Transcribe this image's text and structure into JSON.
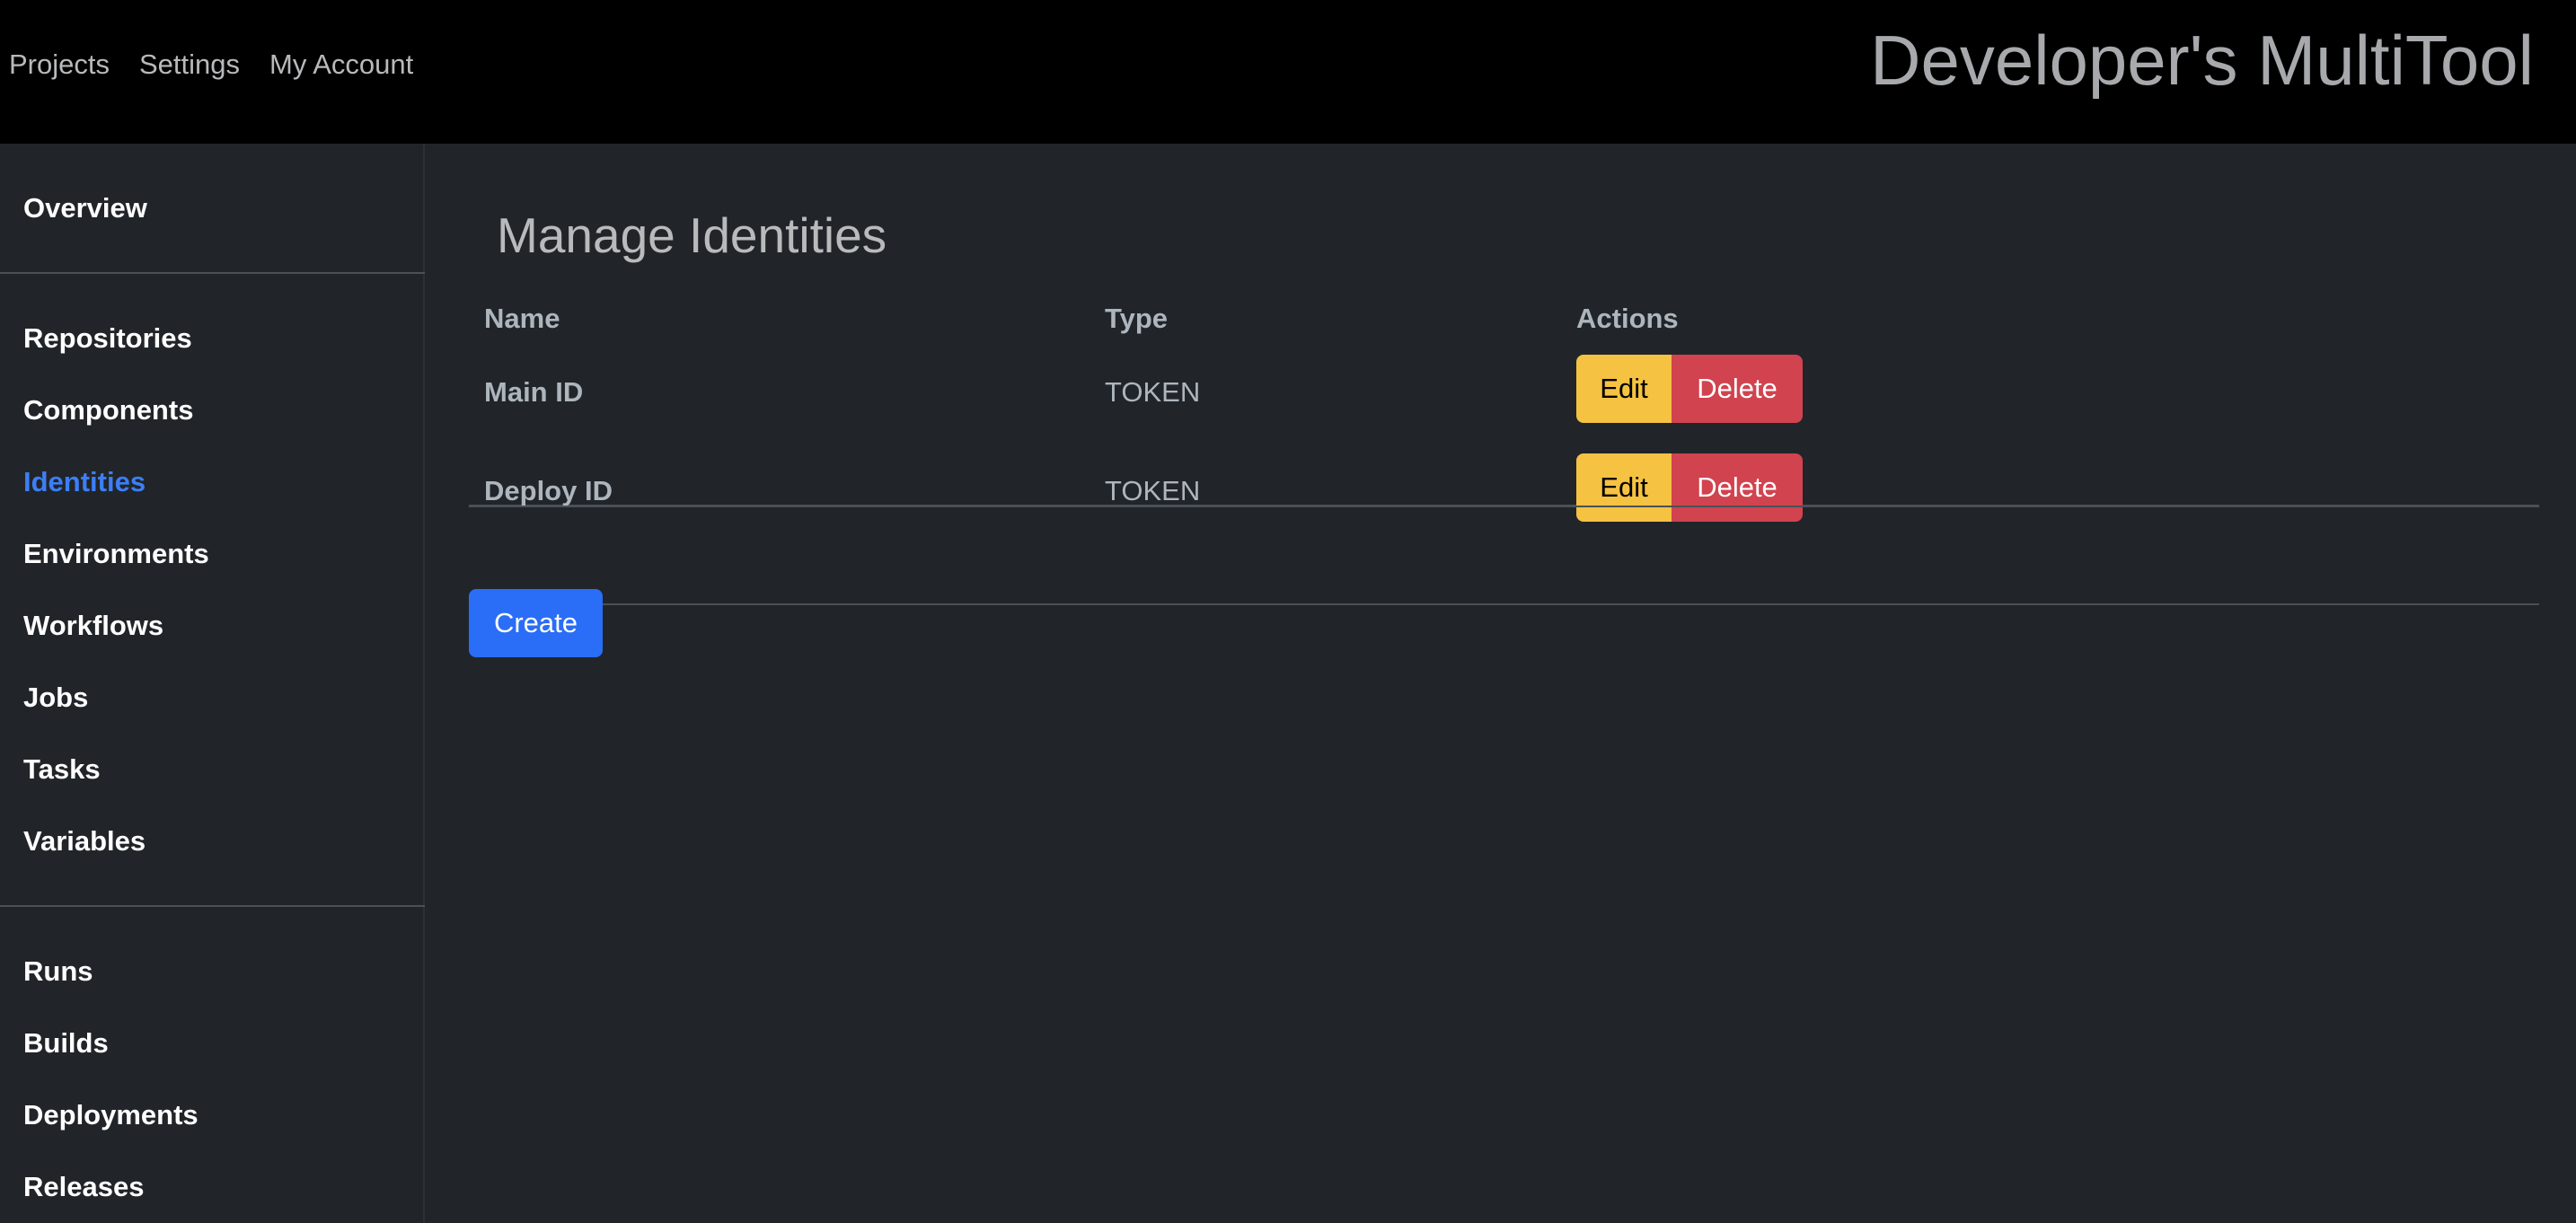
{
  "header": {
    "nav": [
      "Projects",
      "Settings",
      "My Account"
    ],
    "brand": "Developer's MultiTool"
  },
  "sidebar": {
    "groups": [
      [
        {
          "label": "Overview",
          "active": false
        }
      ],
      [
        {
          "label": "Repositories",
          "active": false
        },
        {
          "label": "Components",
          "active": false
        },
        {
          "label": "Identities",
          "active": true
        },
        {
          "label": "Environments",
          "active": false
        },
        {
          "label": "Workflows",
          "active": false
        },
        {
          "label": "Jobs",
          "active": false
        },
        {
          "label": "Tasks",
          "active": false
        },
        {
          "label": "Variables",
          "active": false
        }
      ],
      [
        {
          "label": "Runs",
          "active": false
        },
        {
          "label": "Builds",
          "active": false
        },
        {
          "label": "Deployments",
          "active": false
        },
        {
          "label": "Releases",
          "active": false
        }
      ]
    ]
  },
  "main": {
    "title": "Manage Identities",
    "table": {
      "headers": [
        "Name",
        "Type",
        "Actions"
      ],
      "rows": [
        {
          "name": "Main ID",
          "type": "TOKEN"
        },
        {
          "name": "Deploy ID",
          "type": "TOKEN"
        }
      ],
      "actions": {
        "edit": "Edit",
        "delete": "Delete"
      }
    },
    "create_label": "Create"
  },
  "colors": {
    "active_link": "#3d7ef5",
    "edit_button": "#f5c242",
    "delete_button": "#d1434f",
    "create_button": "#2a6df6"
  }
}
